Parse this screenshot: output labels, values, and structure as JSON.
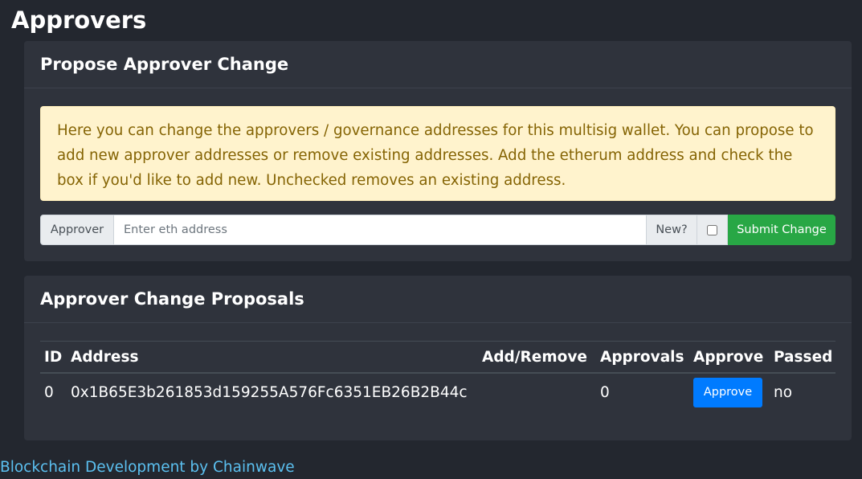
{
  "page": {
    "title": "Approvers"
  },
  "propose": {
    "header": "Propose Approver Change",
    "alert": "Here you can change the approvers / governance addresses for this multisig wallet. You can propose to add new approver addresses or remove existing addresses. Add the etherum address and check the box if you'd like to add new. Unchecked removes an existing address.",
    "input_label": "Approver",
    "input_placeholder": "Enter eth address",
    "input_value": "",
    "new_label": "New?",
    "new_checked": false,
    "submit_label": "Submit Change"
  },
  "proposals": {
    "header": "Approver Change Proposals",
    "columns": [
      "ID",
      "Address",
      "Add/Remove",
      "Approvals",
      "Approve",
      "Passed"
    ],
    "rows": [
      {
        "id": "0",
        "address": "0x1B65E3b261853d159255A576Fc6351EB26B2B44c",
        "add_remove": "",
        "approvals": "0",
        "approve_label": "Approve",
        "passed": "no"
      }
    ]
  },
  "footer": {
    "link": "Blockchain Development by Chainwave"
  },
  "colors": {
    "background": "#23272f",
    "card": "#2f333c",
    "alert_bg": "#fff3cd",
    "alert_text": "#856404",
    "submit": "#28a745",
    "approve": "#007bff",
    "link": "#5bc0f0"
  }
}
